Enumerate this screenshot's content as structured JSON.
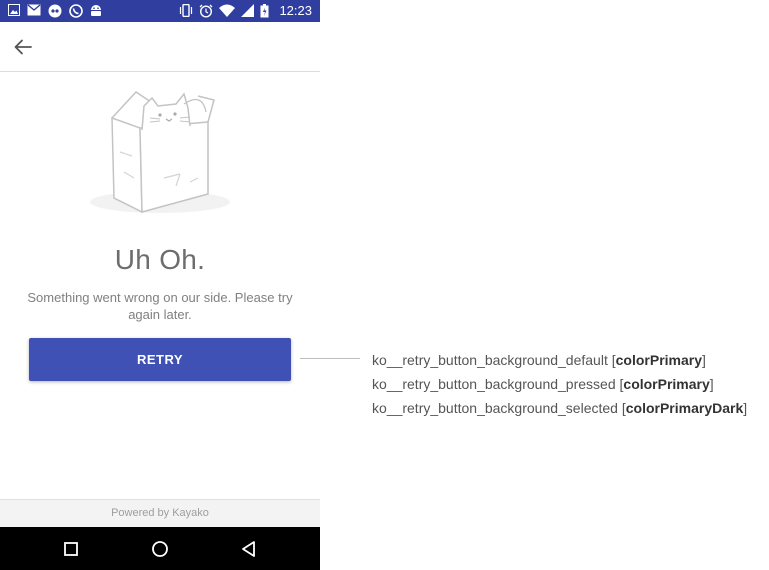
{
  "status_bar": {
    "time": "12:23",
    "left_icons": [
      "image-icon",
      "mail-icon",
      "messenger-icon",
      "whatsapp-icon",
      "android-icon"
    ],
    "right_icons": [
      "vibrate-icon",
      "alarm-icon",
      "wifi-icon",
      "signal-icon",
      "battery-icon"
    ],
    "background": "#303f9f"
  },
  "app_bar": {
    "back_icon": "arrow-back-icon"
  },
  "error": {
    "illustration": "cat-in-box-illustration",
    "title": "Uh Oh.",
    "message": "Something went wrong on our side. Please try again later.",
    "retry_label": "RETRY",
    "retry_color": "#3f51b5"
  },
  "footer": {
    "text": "Powered by Kayako"
  },
  "nav_bar": {
    "buttons": [
      "square-icon",
      "circle-icon",
      "triangle-back-icon"
    ]
  },
  "annotations": [
    {
      "resource": "ko__retry_button_background_default",
      "color_ref": "colorPrimary"
    },
    {
      "resource": "ko__retry_button_background_pressed",
      "color_ref": "colorPrimary"
    },
    {
      "resource": "ko__retry_button_background_selected",
      "color_ref": "colorPrimaryDark"
    }
  ]
}
